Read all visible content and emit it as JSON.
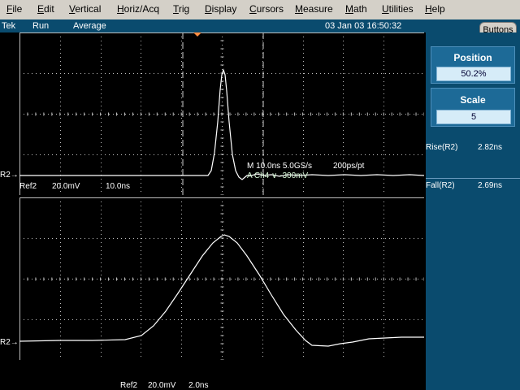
{
  "menu": [
    "File",
    "Edit",
    "Vertical",
    "Horiz/Acq",
    "Trig",
    "Display",
    "Cursors",
    "Measure",
    "Math",
    "Utilities",
    "Help"
  ],
  "status": {
    "brand": "Tek",
    "run": "Run",
    "mode": "Average",
    "datetime": "03 Jan 03 16:50:32",
    "buttons_label": "Buttons"
  },
  "panel": {
    "position_title": "Position",
    "position_value": "50.2%",
    "scale_title": "Scale",
    "scale_value": "5",
    "rise_label": "Rise(R2)",
    "rise_value": "2.82ns",
    "fall_label": "Fall(R2)",
    "fall_value": "2.69ns"
  },
  "top_plot": {
    "ref_label": "Ref2",
    "volts": "20.0mV",
    "time": "10.0ns",
    "channel_marker": "R2",
    "acq_label": "M 10.0ns 5.0GS/s",
    "pts_label": "200ps/pt",
    "trig_label": "A  Ch4  ∨  -300mV"
  },
  "bottom_plot": {
    "ref_label": "Ref2",
    "volts": "20.0mV",
    "time": "2.0ns",
    "channel_marker": "R2"
  },
  "colors": {
    "menubar": "#d4d0c8",
    "status": "#0a4b6e",
    "trace": "#ffffff",
    "grid": "#bfbfbf",
    "trigger_marker": "#ff8c42"
  }
}
